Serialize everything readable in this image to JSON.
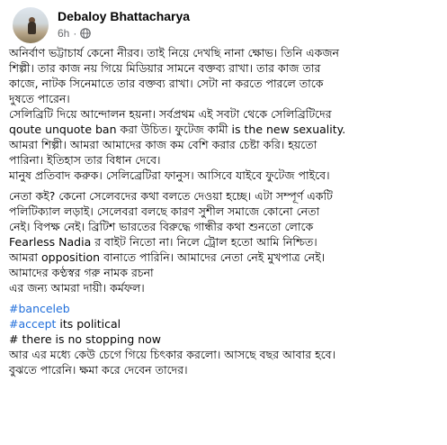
{
  "post": {
    "author": "Debaloy Bhattacharya",
    "time": "6h",
    "separator": "·",
    "paragraphs": [
      [
        "অনির্বাণ ভট্টাচার্য কেনো নীরব। তাই নিয়ে দেখছি নানা ক্ষোভ। তিনি একজন",
        "শিল্পী। তার কাজ নয় গিয়ে মিডিয়ার সামনে বক্তব্য রাখা। তার কাজ তার",
        "কাজে, নাটক সিনেমাতে তার বক্তব্য রাখা। সেটা না করতে পারলে তাকে",
        "দুষতে পারেন।",
        "সেলিব্রিটি দিয়ে আন্দোলন হয়না। সর্বপ্রথম এই সবটা থেকে সেলিব্রিটিদের",
        "qoute unquote ban করা উচিত। ফুটেজ কামী  is the new sexuality.",
        "আমরা শিল্পী। আমরা আমাদের কাজ কম বেশি করার চেষ্টা করি। হয়তো",
        "পারিনা। ইতিহাস তার বিধান দেবে।",
        "মানুষ প্রতিবাদ করুক। সেলিব্রেটিরা ফানুস। আসিবে যাইবে ফুটেজ পাইবে।"
      ],
      [
        "নেতা কই? কেনো সেলেবদের কথা বলতে দেওয়া হচ্ছে। এটা সম্পূর্ণ একটি",
        "পলিটিক্যাল লড়াই। সেলেবরা বলছে কারণ সুশীল সমাজে কোনো নেতা",
        "নেই। বিপক্ষ নেই। ব্রিটিশ ভারতের বিরুদ্ধে গান্ধীর কথা শুনতো লোকে",
        "Fearless Nadia র বাইট নিতো না। নিলে ট্রোল হতো আমি নিশ্চিত।",
        "আমরা opposition বানাতে পারিনি। আমাদের নেতা নেই মুখপাত্র নেই।",
        "আমাদের কণ্ঠস্বর গরু নামক রচনা",
        " এর জন্য আমরা দায়ী। কর্মফল।"
      ]
    ],
    "hashtags": [
      "#banceleb",
      "#accept"
    ],
    "hashtag_suffix": " its political",
    "plain_tag": "# there is no stopping now",
    "closing": [
      "আর এর মধ্যে কেউ চেগে গিয়ে চিৎকার করলো। আসছে বছর আবার হবে।",
      "বুঝতে পারেনি। ক্ষমা করে দেবেন তাদের।"
    ]
  },
  "colors": {
    "hashtag": "#216fdb",
    "meta": "#65676b",
    "text": "#050505"
  },
  "icons": {
    "audience": "globe-icon"
  }
}
